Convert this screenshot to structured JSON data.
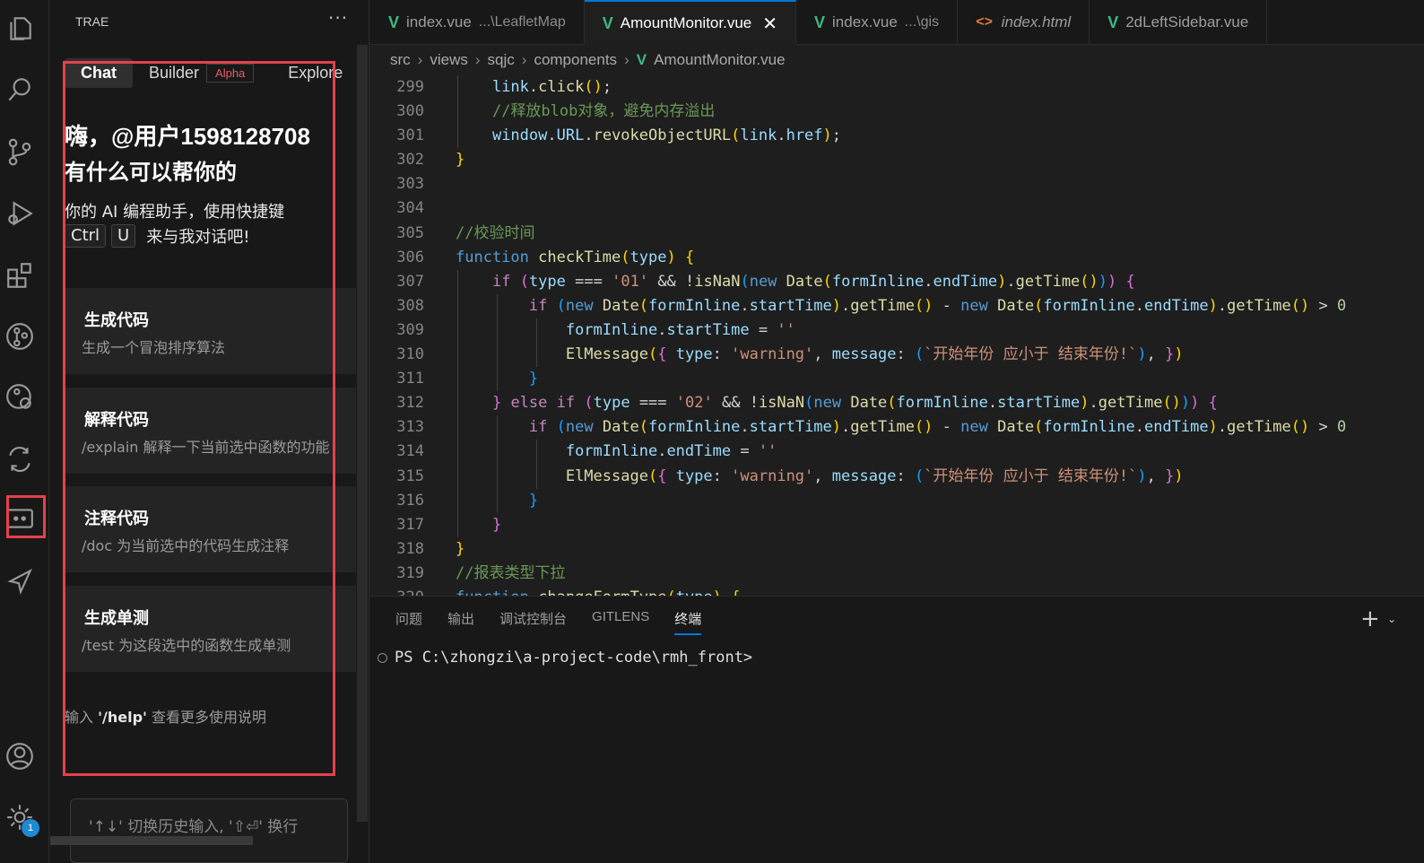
{
  "activity_bar": {
    "icons": [
      "explorer-icon",
      "search-icon",
      "source-control-icon",
      "run-debug-icon",
      "extensions-icon",
      "gitlens-icon",
      "gitlens-inspect-icon",
      "diff-icon",
      "ai-chat-icon",
      "send-icon",
      "account-icon",
      "settings-icon"
    ],
    "settings_badge": "1",
    "highlight_color": "#e5404d"
  },
  "side_panel": {
    "title": "TRAE",
    "more": "···",
    "tabs": [
      {
        "label": "Chat",
        "active": true
      },
      {
        "label": "Builder",
        "badge": "Alpha"
      },
      {
        "label": "Explore"
      }
    ],
    "greeting_line1": "嗨，@用户1598128708",
    "greeting_line2": "有什么可以帮你的",
    "intro_line1": "你的 AI 编程助手，使用快捷键",
    "intro_key1": "Ctrl",
    "intro_key2": "U",
    "intro_line2": "来与我对话吧!",
    "cards": [
      {
        "title": "生成代码",
        "subtitle": "生成一个冒泡排序算法"
      },
      {
        "title": "解释代码",
        "subtitle": "/explain 解释一下当前选中函数的功能"
      },
      {
        "title": "注释代码",
        "subtitle": "/doc 为当前选中的代码生成注释"
      },
      {
        "title": "生成单测",
        "subtitle": "/test 为这段选中的函数生成单测"
      }
    ],
    "help_prefix": "输入 ",
    "help_cmd": "'/help'",
    "help_suffix": " 查看更多使用说明",
    "input_placeholder": "'↑↓' 切换历史输入, '⇧⏎' 换行"
  },
  "editor": {
    "tabs": [
      {
        "name": "index.vue",
        "desc": "...\\LeafletMap",
        "type": "vue"
      },
      {
        "name": "AmountMonitor.vue",
        "type": "vue",
        "active": true
      },
      {
        "name": "index.vue",
        "desc": "...\\gis",
        "type": "vue"
      },
      {
        "name": "index.html",
        "type": "html"
      },
      {
        "name": "2dLeftSidebar.vue",
        "type": "vue"
      }
    ],
    "close_glyph": "✕",
    "breadcrumb": [
      "src",
      "views",
      "sqjc",
      "components",
      "AmountMonitor.vue"
    ],
    "line_numbers": [
      "299",
      "300",
      "301",
      "302",
      "303",
      "304",
      "305",
      "306",
      "307",
      "308",
      "309",
      "310",
      "311",
      "312",
      "313",
      "314",
      "315",
      "316",
      "317",
      "318",
      "319",
      "320"
    ],
    "code_text": {
      "c300": "//释放blob对象，避免内存溢出",
      "c305": "//校验时间",
      "s01": "'01'",
      "s02": "'02'",
      "empty": "''",
      "warning": "'warning'",
      "msg": "`开始年份 应小于 结束年份!`",
      "c319": "//报表类型下拉"
    }
  },
  "bottom_panel": {
    "tabs": [
      {
        "label": "问题"
      },
      {
        "label": "输出"
      },
      {
        "label": "调试控制台"
      },
      {
        "label": "GITLENS"
      },
      {
        "label": "终端",
        "active": true
      }
    ],
    "terminal_prompt": "PS C:\\zhongzi\\a-project-code\\rmh_front>"
  },
  "colors": {
    "accent": "#0078d4",
    "vue_green": "#41b883",
    "highlight_red": "#e5404d",
    "badge_blue": "#1f8ad2"
  }
}
